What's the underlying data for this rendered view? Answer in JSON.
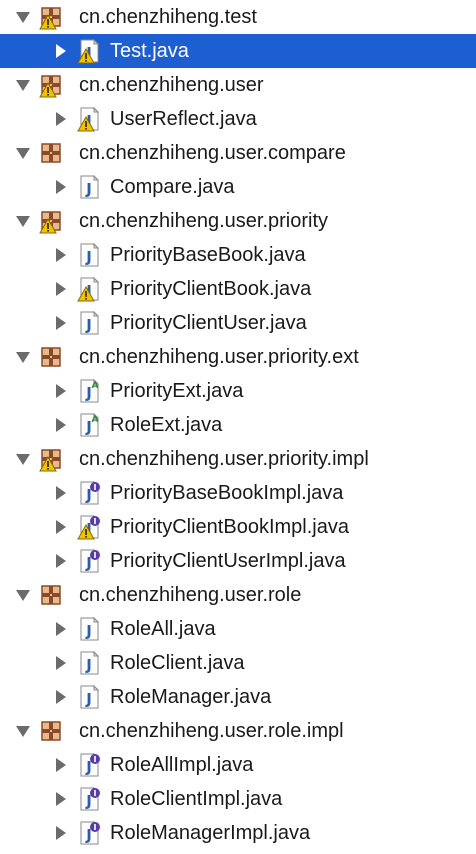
{
  "tree": [
    {
      "kind": "package",
      "label": "cn.chenzhiheng.test",
      "expanded": true,
      "warning": true,
      "children": [
        {
          "label": "Test.java",
          "icon": "java-class-icon",
          "warning": true,
          "selected": true
        }
      ]
    },
    {
      "kind": "package",
      "label": "cn.chenzhiheng.user",
      "expanded": true,
      "warning": true,
      "children": [
        {
          "label": "UserReflect.java",
          "icon": "java-class-icon",
          "warning": true
        }
      ]
    },
    {
      "kind": "package",
      "label": "cn.chenzhiheng.user.compare",
      "expanded": true,
      "warning": false,
      "children": [
        {
          "label": "Compare.java",
          "icon": "java-class-icon",
          "warning": false
        }
      ]
    },
    {
      "kind": "package",
      "label": "cn.chenzhiheng.user.priority",
      "expanded": true,
      "warning": true,
      "children": [
        {
          "label": "PriorityBaseBook.java",
          "icon": "java-class-icon",
          "warning": false
        },
        {
          "label": "PriorityClientBook.java",
          "icon": "java-class-icon",
          "warning": true
        },
        {
          "label": "PriorityClientUser.java",
          "icon": "java-class-icon",
          "warning": false
        }
      ]
    },
    {
      "kind": "package",
      "label": "cn.chenzhiheng.user.priority.ext",
      "expanded": true,
      "warning": false,
      "children": [
        {
          "label": "PriorityExt.java",
          "icon": "java-abstract-class-icon",
          "warning": false
        },
        {
          "label": "RoleExt.java",
          "icon": "java-abstract-class-icon",
          "warning": false
        }
      ]
    },
    {
      "kind": "package",
      "label": "cn.chenzhiheng.user.priority.impl",
      "expanded": true,
      "warning": true,
      "children": [
        {
          "label": "PriorityBaseBookImpl.java",
          "icon": "java-interface-icon",
          "warning": false
        },
        {
          "label": "PriorityClientBookImpl.java",
          "icon": "java-interface-icon",
          "warning": true
        },
        {
          "label": "PriorityClientUserImpl.java",
          "icon": "java-interface-icon",
          "warning": false
        }
      ]
    },
    {
      "kind": "package",
      "label": "cn.chenzhiheng.user.role",
      "expanded": true,
      "warning": false,
      "children": [
        {
          "label": "RoleAll.java",
          "icon": "java-class-icon",
          "warning": false
        },
        {
          "label": "RoleClient.java",
          "icon": "java-class-icon",
          "warning": false
        },
        {
          "label": "RoleManager.java",
          "icon": "java-class-icon",
          "warning": false
        }
      ]
    },
    {
      "kind": "package",
      "label": "cn.chenzhiheng.user.role.impl",
      "expanded": true,
      "warning": false,
      "children": [
        {
          "label": "RoleAllImpl.java",
          "icon": "java-interface-icon",
          "warning": false
        },
        {
          "label": "RoleClientImpl.java",
          "icon": "java-interface-icon",
          "warning": false
        },
        {
          "label": "RoleManagerImpl.java",
          "icon": "java-interface-icon",
          "warning": false
        }
      ]
    }
  ],
  "colors": {
    "selection": "#1d5fd1",
    "package_brown": "#8a4b2a",
    "package_fill": "#e8b98a",
    "warning_yellow": "#f2c200",
    "java_blue": "#2a5ea8",
    "interface_purple": "#5a3aa8",
    "abstract_green": "#2f8a3a"
  }
}
